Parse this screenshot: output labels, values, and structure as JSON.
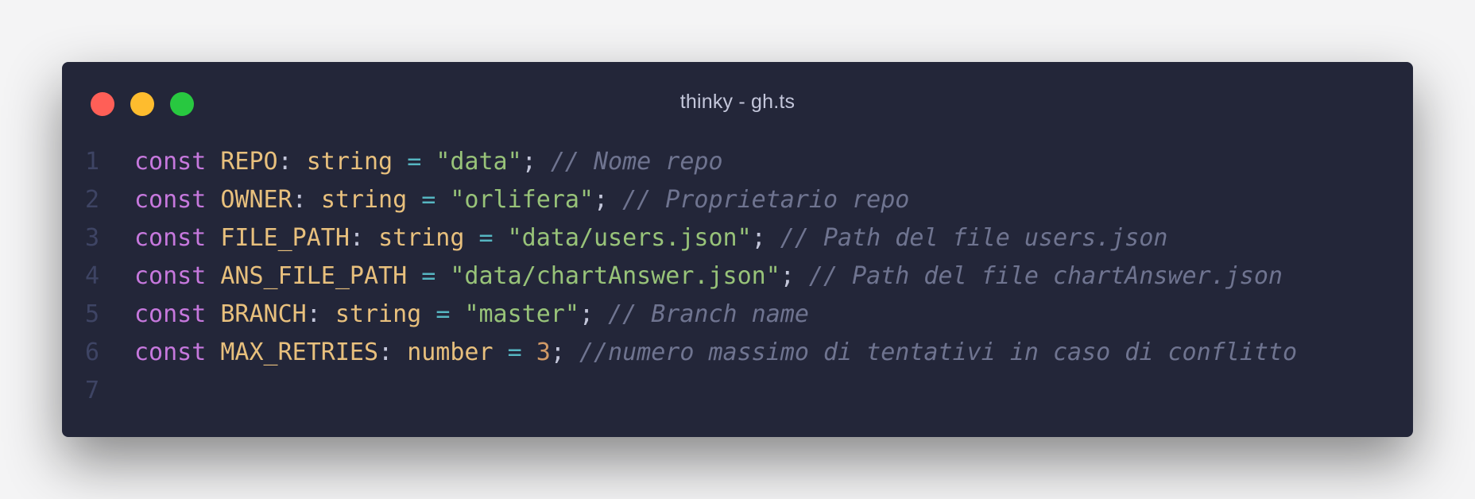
{
  "window": {
    "title": "thinky - gh.ts",
    "controls": [
      "close",
      "minimize",
      "maximize"
    ],
    "colors": {
      "background": "#232639",
      "close": "#ff5f57",
      "minimize": "#febc2e",
      "maximize": "#28c840"
    }
  },
  "editor": {
    "syntax_colors": {
      "keyword": "#c678dd",
      "identifier": "#e8c07d",
      "string": "#98c379",
      "operator": "#56b6c2",
      "number": "#d19a66",
      "comment": "#6f7490"
    },
    "lines": [
      {
        "number": "1",
        "tokens": [
          {
            "text": "const",
            "kind": "kw"
          },
          {
            "text": " ",
            "kind": "pn"
          },
          {
            "text": "REPO",
            "kind": "id"
          },
          {
            "text": ": ",
            "kind": "pn"
          },
          {
            "text": "string",
            "kind": "ty"
          },
          {
            "text": " ",
            "kind": "pn"
          },
          {
            "text": "=",
            "kind": "op"
          },
          {
            "text": " ",
            "kind": "pn"
          },
          {
            "text": "\"data\"",
            "kind": "st"
          },
          {
            "text": "; ",
            "kind": "pn"
          },
          {
            "text": "// Nome repo",
            "kind": "cm"
          }
        ]
      },
      {
        "number": "2",
        "tokens": [
          {
            "text": "const",
            "kind": "kw"
          },
          {
            "text": " ",
            "kind": "pn"
          },
          {
            "text": "OWNER",
            "kind": "id"
          },
          {
            "text": ": ",
            "kind": "pn"
          },
          {
            "text": "string",
            "kind": "ty"
          },
          {
            "text": " ",
            "kind": "pn"
          },
          {
            "text": "=",
            "kind": "op"
          },
          {
            "text": " ",
            "kind": "pn"
          },
          {
            "text": "\"orlifera\"",
            "kind": "st"
          },
          {
            "text": "; ",
            "kind": "pn"
          },
          {
            "text": "// Proprietario repo",
            "kind": "cm"
          }
        ]
      },
      {
        "number": "3",
        "tokens": [
          {
            "text": "const",
            "kind": "kw"
          },
          {
            "text": " ",
            "kind": "pn"
          },
          {
            "text": "FILE_PATH",
            "kind": "id"
          },
          {
            "text": ": ",
            "kind": "pn"
          },
          {
            "text": "string",
            "kind": "ty"
          },
          {
            "text": " ",
            "kind": "pn"
          },
          {
            "text": "=",
            "kind": "op"
          },
          {
            "text": " ",
            "kind": "pn"
          },
          {
            "text": "\"data/users.json\"",
            "kind": "st"
          },
          {
            "text": "; ",
            "kind": "pn"
          },
          {
            "text": "// Path del file users.json",
            "kind": "cm"
          }
        ]
      },
      {
        "number": "4",
        "tokens": [
          {
            "text": "const",
            "kind": "kw"
          },
          {
            "text": " ",
            "kind": "pn"
          },
          {
            "text": "ANS_FILE_PATH",
            "kind": "id"
          },
          {
            "text": " ",
            "kind": "pn"
          },
          {
            "text": "=",
            "kind": "op"
          },
          {
            "text": " ",
            "kind": "pn"
          },
          {
            "text": "\"data/chartAnswer.json\"",
            "kind": "st"
          },
          {
            "text": "; ",
            "kind": "pn"
          },
          {
            "text": "// Path del file chartAnswer.json",
            "kind": "cm"
          }
        ]
      },
      {
        "number": "5",
        "tokens": [
          {
            "text": "const",
            "kind": "kw"
          },
          {
            "text": " ",
            "kind": "pn"
          },
          {
            "text": "BRANCH",
            "kind": "id"
          },
          {
            "text": ": ",
            "kind": "pn"
          },
          {
            "text": "string",
            "kind": "ty"
          },
          {
            "text": " ",
            "kind": "pn"
          },
          {
            "text": "=",
            "kind": "op"
          },
          {
            "text": " ",
            "kind": "pn"
          },
          {
            "text": "\"master\"",
            "kind": "st"
          },
          {
            "text": "; ",
            "kind": "pn"
          },
          {
            "text": "// Branch name",
            "kind": "cm"
          }
        ]
      },
      {
        "number": "6",
        "tokens": [
          {
            "text": "const",
            "kind": "kw"
          },
          {
            "text": " ",
            "kind": "pn"
          },
          {
            "text": "MAX_RETRIES",
            "kind": "id"
          },
          {
            "text": ": ",
            "kind": "pn"
          },
          {
            "text": "number",
            "kind": "ty"
          },
          {
            "text": " ",
            "kind": "pn"
          },
          {
            "text": "=",
            "kind": "op"
          },
          {
            "text": " ",
            "kind": "pn"
          },
          {
            "text": "3",
            "kind": "nu"
          },
          {
            "text": "; ",
            "kind": "pn"
          },
          {
            "text": "//numero massimo di tentativi in caso di conflitto",
            "kind": "cm"
          }
        ]
      },
      {
        "number": "7",
        "tokens": []
      }
    ]
  }
}
